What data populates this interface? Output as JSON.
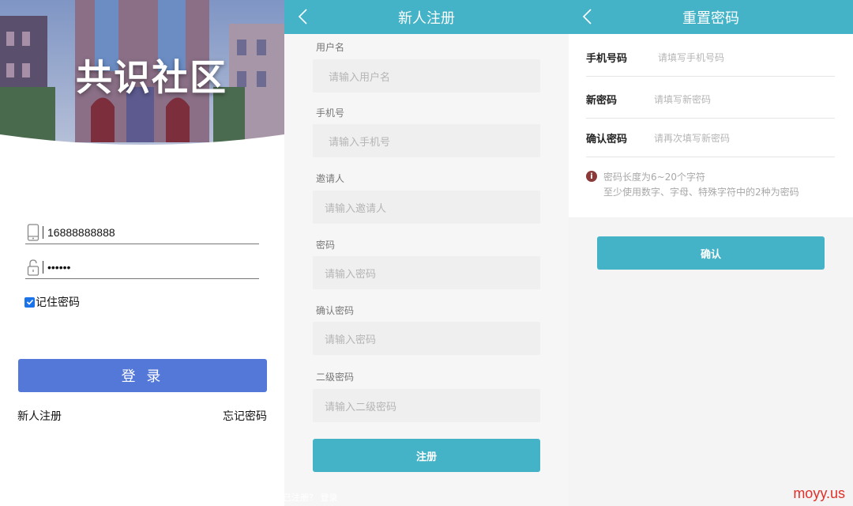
{
  "login": {
    "hero_title": "共识社区",
    "phone_value": "16888888888",
    "password_value": "••••••",
    "remember_label": "记住密码",
    "remember_checked": true,
    "login_button": "登 录",
    "register_link": "新人注册",
    "forgot_link": "忘记密码",
    "accent_color": "#5478d8"
  },
  "register": {
    "title": "新人注册",
    "fields": [
      {
        "label": "用户名",
        "placeholder": "请输入用户名"
      },
      {
        "label": "手机号",
        "placeholder": "请输入手机号"
      },
      {
        "label": "邀请人",
        "placeholder": "请输入邀请人"
      },
      {
        "label": "密码",
        "placeholder": "请输入密码"
      },
      {
        "label": "确认密码",
        "placeholder": "请输入密码"
      },
      {
        "label": "二级密码",
        "placeholder": "请输入二级密码"
      }
    ],
    "submit_button": "注册",
    "footer_ghost_text": "已注册？ 登录",
    "accent_color": "#45b3c7"
  },
  "reset": {
    "title": "重置密码",
    "fields": [
      {
        "label": "手机号码",
        "placeholder": "请填写手机号码"
      },
      {
        "label": "新密码",
        "placeholder": "请填写新密码"
      },
      {
        "label": "确认密码",
        "placeholder": "请再次填写新密码"
      }
    ],
    "hint_line1": "密码长度为6~20个字符",
    "hint_line2": "至少使用数字、字母、特殊字符中的2种为密码",
    "confirm_button": "确认"
  },
  "watermark": "moyy.us"
}
